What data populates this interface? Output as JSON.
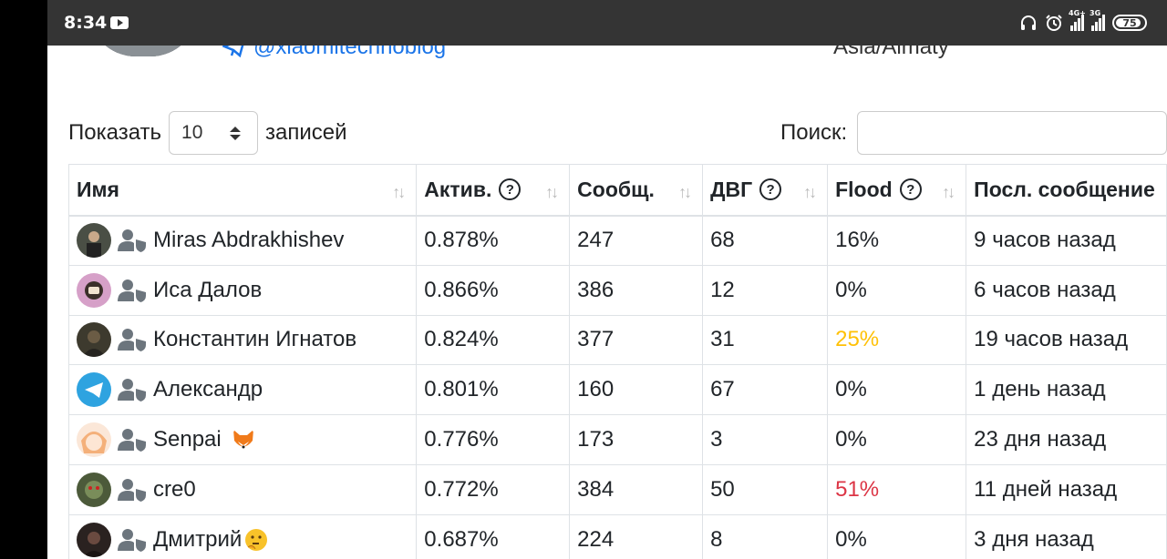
{
  "status_bar": {
    "time": "8:34",
    "network_1": "4G+",
    "network_2": "3G",
    "battery": "75"
  },
  "profile": {
    "telegram_handle": "@xiaomitechnoblog",
    "timezone": "Asia/Almaty"
  },
  "controls": {
    "show_label": "Показать",
    "page_length": "10",
    "entries_label": "записей",
    "search_label": "Поиск:",
    "search_value": ""
  },
  "table": {
    "columns": [
      {
        "label": "Имя",
        "help": false
      },
      {
        "label": "Актив.",
        "help": true
      },
      {
        "label": "Сообщ.",
        "help": false
      },
      {
        "label": "ДВГ",
        "help": true
      },
      {
        "label": "Flood",
        "help": true
      },
      {
        "label": "Посл. сообщение",
        "help": false
      }
    ],
    "rows": [
      {
        "name": "Miras Abdrakhishev",
        "activity": "0.878%",
        "messages": "247",
        "dvg": "68",
        "flood": "16%",
        "last": "9 часов назад"
      },
      {
        "name": "Иса Далов",
        "activity": "0.866%",
        "messages": "386",
        "dvg": "12",
        "flood": "0%",
        "last": "6 часов назад"
      },
      {
        "name": "Константин Игнатов",
        "activity": "0.824%",
        "messages": "377",
        "dvg": "31",
        "flood": "25%",
        "last": "19 часов назад"
      },
      {
        "name": "Александр",
        "activity": "0.801%",
        "messages": "160",
        "dvg": "67",
        "flood": "0%",
        "last": "1 день назад"
      },
      {
        "name": "Senpai",
        "activity": "0.776%",
        "messages": "173",
        "dvg": "3",
        "flood": "0%",
        "last": "23 дня назад"
      },
      {
        "name": "cre0",
        "activity": "0.772%",
        "messages": "384",
        "dvg": "50",
        "flood": "51%",
        "last": "11 дней назад"
      },
      {
        "name": "Дмитрий",
        "activity": "0.687%",
        "messages": "224",
        "dvg": "8",
        "flood": "0%",
        "last": "3 дня назад"
      }
    ]
  },
  "colors": {
    "link": "#1a74e8",
    "flood_warn": "#ffc107",
    "flood_danger": "#dc3545"
  }
}
